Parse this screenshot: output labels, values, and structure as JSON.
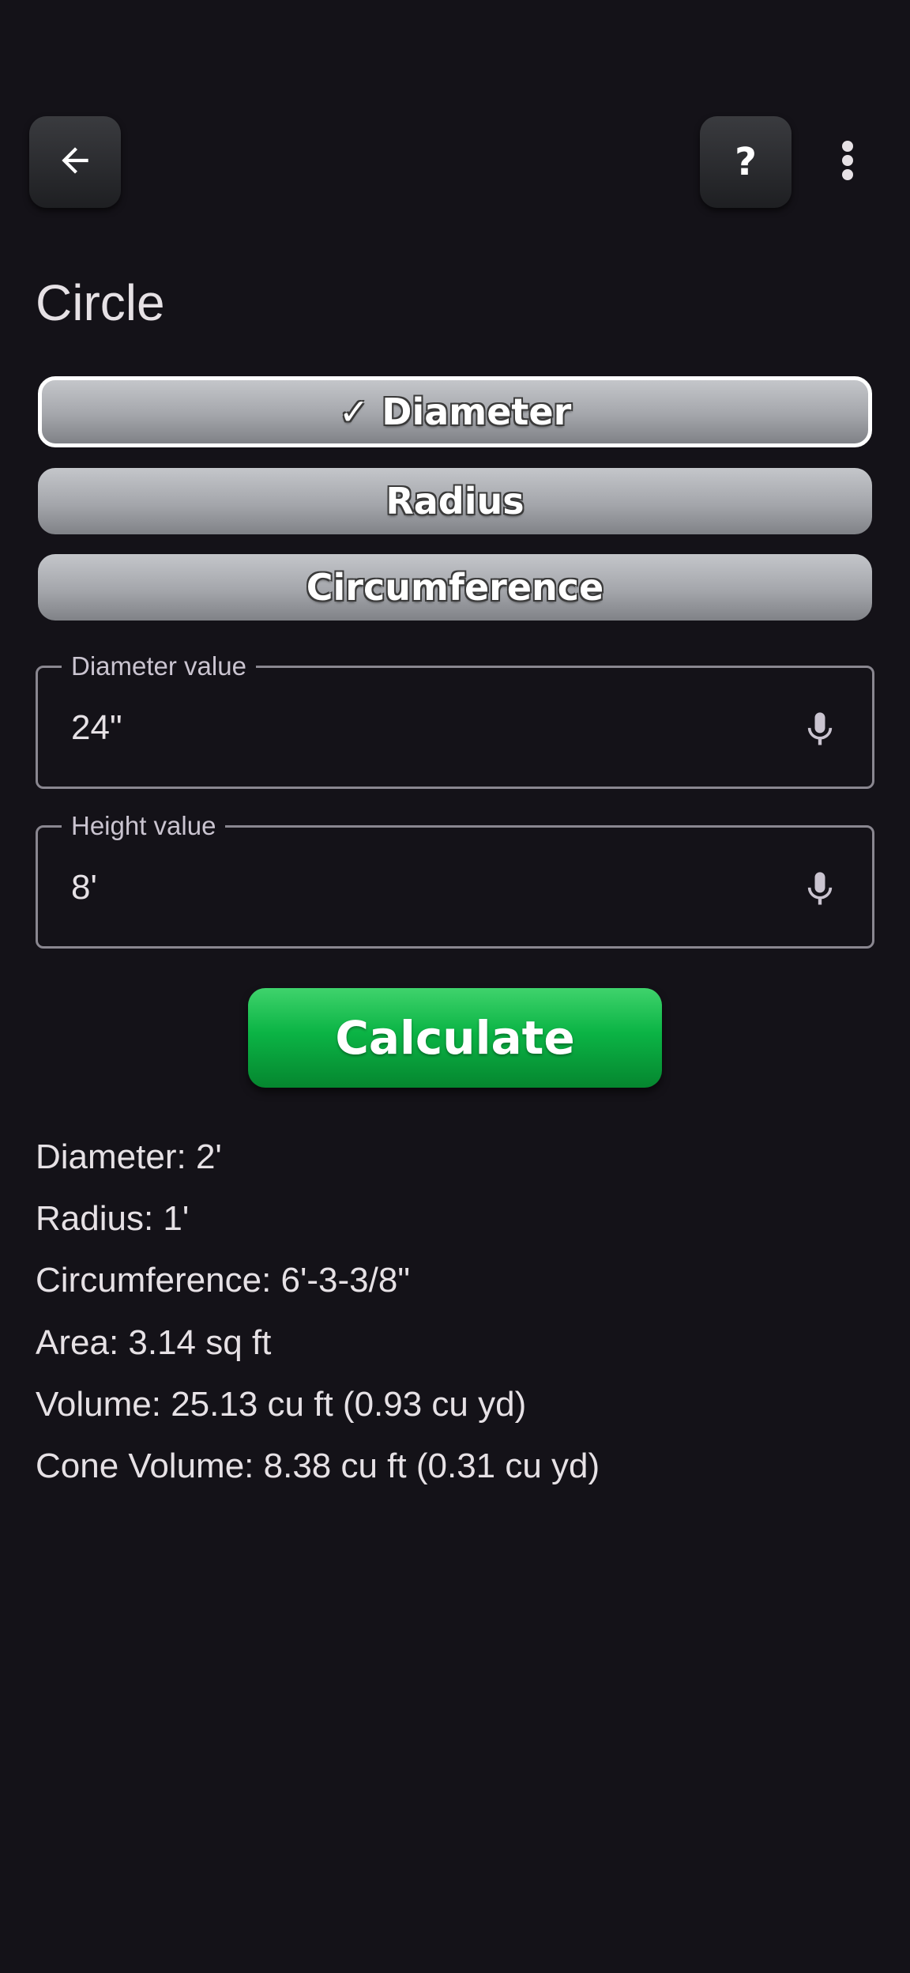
{
  "header": {
    "back_icon": "arrow-left-icon",
    "help_label": "?",
    "menu_icon": "more-vertical-icon"
  },
  "page": {
    "title": "Circle"
  },
  "mode_selector": {
    "diameter_label": "✓ Diameter",
    "radius_label": "Radius",
    "circumference_label": "Circumference",
    "selected": "Diameter"
  },
  "inputs": {
    "diameter": {
      "label": "Diameter value",
      "value": "24\"",
      "icon": "microphone-icon"
    },
    "height": {
      "label": "Height value",
      "value": "8'",
      "icon": "microphone-icon"
    }
  },
  "calculate_label": "Calculate",
  "results": [
    "Diameter: 2'",
    "Radius: 1'",
    "Circumference: 6'-3-3/8\"",
    "Area: 3.14 sq ft",
    "Volume: 25.13 cu ft (0.93 cu yd)",
    "Cone Volume: 8.38 cu ft (0.31 cu yd)"
  ],
  "colors": {
    "background": "#141218",
    "calculate_button": "#0bb445",
    "segment_button": "#b4b6ba",
    "text": "#e6e1e5"
  }
}
